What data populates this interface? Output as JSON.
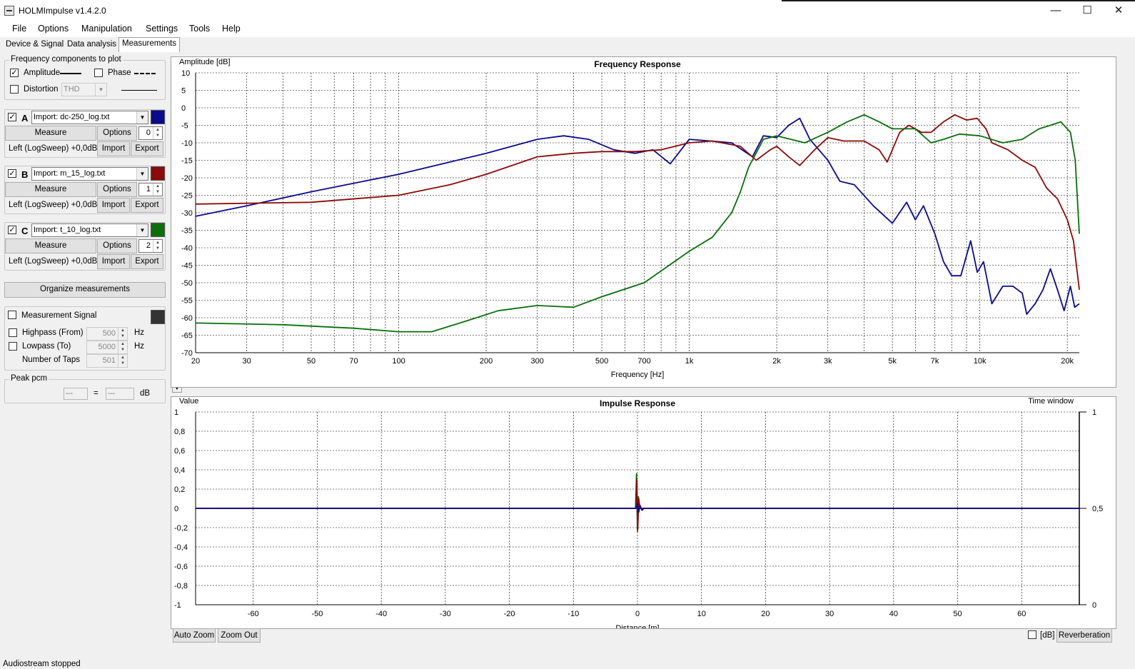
{
  "window": {
    "title": "HOLMImpulse  v1.4.2.0",
    "controls": {
      "minimize": "—",
      "maximize": "☐",
      "close": "✕"
    }
  },
  "menu": [
    "File",
    "Options",
    "Manipulation",
    "Settings",
    "Tools",
    "Help"
  ],
  "tabs": [
    {
      "label": "Device & Signal",
      "active": false
    },
    {
      "label": "Data analysis",
      "active": false
    },
    {
      "label": "Measurements",
      "active": true
    }
  ],
  "freq_components": {
    "title": "Frequency components to plot",
    "amplitude": {
      "label": "Amplitude",
      "checked": true
    },
    "phase": {
      "label": "Phase",
      "checked": false
    },
    "distortion": {
      "label": "Distortion",
      "checked": false,
      "select_value": "THD"
    }
  },
  "measurements": [
    {
      "letter": "A",
      "checked": true,
      "file": "Import: dc-250_log.txt",
      "color": "#0a0a8c",
      "offset": "0",
      "info": "Left (LogSweep) +0,0dB",
      "measure": "Measure",
      "options": "Options",
      "import": "Import",
      "export": "Export"
    },
    {
      "letter": "B",
      "checked": true,
      "file": "Import: m_15_log.txt",
      "color": "#8b0a0a",
      "offset": "1",
      "info": "Left (LogSweep) +0,0dB",
      "measure": "Measure",
      "options": "Options",
      "import": "Import",
      "export": "Export"
    },
    {
      "letter": "C",
      "checked": true,
      "file": "Import: t_10_log.txt",
      "color": "#0a6e0a",
      "offset": "2",
      "info": "Left (LogSweep) +0,0dB",
      "measure": "Measure",
      "options": "Options",
      "import": "Import",
      "export": "Export"
    }
  ],
  "organize_button": "Organize measurements",
  "measurement_signal": {
    "label": "Measurement Signal",
    "checked": false,
    "color": "#333333",
    "highpass": {
      "label": "Highpass (From)",
      "value": "500",
      "unit": "Hz"
    },
    "lowpass": {
      "label": "Lowpass (To)",
      "value": "5000",
      "unit": "Hz"
    },
    "taps": {
      "label": "Number of Taps",
      "value": "501"
    }
  },
  "peak_pcm": {
    "title": "Peak pcm",
    "value1": "---",
    "equals": "=",
    "value2": "---",
    "unit": "dB"
  },
  "scroll_arrows": {
    "up": "▲",
    "down": "▼"
  },
  "chart_data": [
    {
      "type": "line",
      "title": "Frequency Response",
      "xlabel": "Frequency [Hz]",
      "ylabel": "Amplitude [dB]",
      "xscale": "log",
      "xlim": [
        20,
        22000
      ],
      "ylim": [
        -70,
        10
      ],
      "grid": true,
      "x_ticks": [
        20,
        30,
        50,
        70,
        100,
        200,
        300,
        500,
        700,
        1000,
        2000,
        3000,
        5000,
        7000,
        10000,
        20000
      ],
      "x_tick_labels": [
        "20",
        "30",
        "50",
        "70",
        "100",
        "200",
        "300",
        "500",
        "700",
        "1k",
        "2k",
        "3k",
        "5k",
        "7k",
        "10k",
        "20k"
      ],
      "y_ticks": [
        10,
        5,
        0,
        -5,
        -10,
        -15,
        -20,
        -25,
        -30,
        -35,
        -40,
        -45,
        -50,
        -55,
        -60,
        -65,
        -70
      ],
      "series": [
        {
          "color": "#0a0a8c",
          "points": [
            [
              20,
              -31
            ],
            [
              30,
              -28
            ],
            [
              50,
              -24
            ],
            [
              100,
              -19
            ],
            [
              200,
              -13
            ],
            [
              300,
              -9
            ],
            [
              370,
              -8
            ],
            [
              450,
              -9
            ],
            [
              550,
              -12
            ],
            [
              650,
              -13
            ],
            [
              750,
              -12
            ],
            [
              860,
              -16
            ],
            [
              1000,
              -9
            ],
            [
              1400,
              -10
            ],
            [
              1650,
              -14
            ],
            [
              1800,
              -8
            ],
            [
              2000,
              -8.5
            ],
            [
              2200,
              -5
            ],
            [
              2400,
              -3
            ],
            [
              2600,
              -9
            ],
            [
              3000,
              -15
            ],
            [
              3300,
              -21
            ],
            [
              3700,
              -22
            ],
            [
              4300,
              -28
            ],
            [
              5000,
              -33
            ],
            [
              5600,
              -27
            ],
            [
              6000,
              -32
            ],
            [
              6400,
              -28
            ],
            [
              7000,
              -36
            ],
            [
              7500,
              -44
            ],
            [
              8000,
              -48
            ],
            [
              8600,
              -48
            ],
            [
              9300,
              -38
            ],
            [
              9800,
              -47
            ],
            [
              10300,
              -44
            ],
            [
              11000,
              -56
            ],
            [
              12000,
              -51
            ],
            [
              13000,
              -51
            ],
            [
              14000,
              -53
            ],
            [
              14500,
              -59
            ],
            [
              15500,
              -56
            ],
            [
              16500,
              -52
            ],
            [
              17500,
              -46
            ],
            [
              18500,
              -52
            ],
            [
              19500,
              -58
            ],
            [
              20500,
              -51
            ],
            [
              21200,
              -57
            ],
            [
              22000,
              -56
            ]
          ]
        },
        {
          "color": "#8b0a0a",
          "points": [
            [
              20,
              -27.5
            ],
            [
              50,
              -27
            ],
            [
              100,
              -25
            ],
            [
              150,
              -22
            ],
            [
              200,
              -19
            ],
            [
              300,
              -14
            ],
            [
              400,
              -13
            ],
            [
              500,
              -12.5
            ],
            [
              650,
              -12.5
            ],
            [
              800,
              -12
            ],
            [
              1000,
              -10
            ],
            [
              1200,
              -9.5
            ],
            [
              1500,
              -11
            ],
            [
              1700,
              -15
            ],
            [
              1900,
              -12
            ],
            [
              2000,
              -11
            ],
            [
              2200,
              -14
            ],
            [
              2400,
              -16.5
            ],
            [
              2700,
              -12
            ],
            [
              3000,
              -8.5
            ],
            [
              3400,
              -9.5
            ],
            [
              4000,
              -9.5
            ],
            [
              4500,
              -12
            ],
            [
              4800,
              -15.5
            ],
            [
              5300,
              -7
            ],
            [
              5700,
              -5
            ],
            [
              6300,
              -7
            ],
            [
              6800,
              -7
            ],
            [
              7500,
              -4
            ],
            [
              8200,
              -2
            ],
            [
              9000,
              -3.5
            ],
            [
              9800,
              -3
            ],
            [
              10500,
              -6
            ],
            [
              11000,
              -10
            ],
            [
              12500,
              -12
            ],
            [
              14000,
              -15
            ],
            [
              15500,
              -17
            ],
            [
              17000,
              -23
            ],
            [
              18500,
              -26
            ],
            [
              20000,
              -32
            ],
            [
              21000,
              -38
            ],
            [
              22000,
              -52
            ]
          ]
        },
        {
          "color": "#0a6e0a",
          "points": [
            [
              20,
              -61.5
            ],
            [
              40,
              -62
            ],
            [
              70,
              -63
            ],
            [
              100,
              -64
            ],
            [
              130,
              -64
            ],
            [
              170,
              -61
            ],
            [
              220,
              -58
            ],
            [
              300,
              -56.5
            ],
            [
              400,
              -57
            ],
            [
              500,
              -54
            ],
            [
              700,
              -50
            ],
            [
              1000,
              -41
            ],
            [
              1200,
              -37
            ],
            [
              1400,
              -30
            ],
            [
              1500,
              -24
            ],
            [
              1600,
              -17
            ],
            [
              1800,
              -9
            ],
            [
              2000,
              -8
            ],
            [
              2500,
              -10
            ],
            [
              3000,
              -7
            ],
            [
              3500,
              -4
            ],
            [
              4000,
              -2
            ],
            [
              4500,
              -4
            ],
            [
              5000,
              -6
            ],
            [
              6000,
              -6
            ],
            [
              6800,
              -10
            ],
            [
              7500,
              -9
            ],
            [
              8500,
              -7.5
            ],
            [
              10000,
              -8
            ],
            [
              12000,
              -10
            ],
            [
              14000,
              -9
            ],
            [
              16000,
              -6
            ],
            [
              17500,
              -5
            ],
            [
              19000,
              -4
            ],
            [
              20500,
              -7
            ],
            [
              21300,
              -15
            ],
            [
              22000,
              -36
            ]
          ]
        }
      ]
    },
    {
      "type": "line",
      "title": "Impulse Response",
      "xlabel": "Distance [m]",
      "ylabel": "Value",
      "y2label": "Time window",
      "xlim": [
        -69,
        69
      ],
      "ylim": [
        -1,
        1
      ],
      "grid": true,
      "x_ticks": [
        -60,
        -50,
        -40,
        -30,
        -20,
        -10,
        0,
        10,
        20,
        30,
        40,
        50,
        60
      ],
      "y_ticks": [
        1,
        0.8,
        0.6,
        0.4,
        0.2,
        0,
        -0.2,
        -0.4,
        -0.6,
        -0.8,
        -1
      ],
      "y_tick_labels": [
        "1",
        "0,8",
        "0,6",
        "0,4",
        "0,2",
        "0",
        "-0,2",
        "-0,4",
        "-0,6",
        "-0,8",
        "-1"
      ],
      "y2_tick_labels": [
        "1",
        "0,5",
        "0"
      ],
      "series": [
        {
          "color": "#0a6e0a",
          "points": [
            [
              -69,
              0
            ],
            [
              -0.3,
              0
            ],
            [
              -0.15,
              0.36
            ],
            [
              0,
              -0.24
            ],
            [
              0.15,
              0.12
            ],
            [
              0.35,
              0
            ],
            [
              69,
              0
            ]
          ]
        },
        {
          "color": "#8b0a0a",
          "points": [
            [
              -69,
              0
            ],
            [
              -0.25,
              0
            ],
            [
              -0.1,
              0.3
            ],
            [
              0.05,
              -0.22
            ],
            [
              0.2,
              0.1
            ],
            [
              0.4,
              0
            ],
            [
              69,
              0
            ]
          ]
        },
        {
          "color": "#0a0a8c",
          "points": [
            [
              -69,
              0
            ],
            [
              -0.2,
              0
            ],
            [
              0,
              0.05
            ],
            [
              0.2,
              -0.04
            ],
            [
              0.4,
              0.03
            ],
            [
              0.7,
              -0.02
            ],
            [
              1,
              0
            ],
            [
              69,
              0
            ]
          ]
        }
      ]
    }
  ],
  "impulse_buttons": {
    "auto_zoom": "Auto Zoom",
    "zoom_out": "Zoom Out",
    "db_label": "[dB]",
    "db_checked": false,
    "reverberation": "Reverberation"
  },
  "status": "Audiostream stopped"
}
